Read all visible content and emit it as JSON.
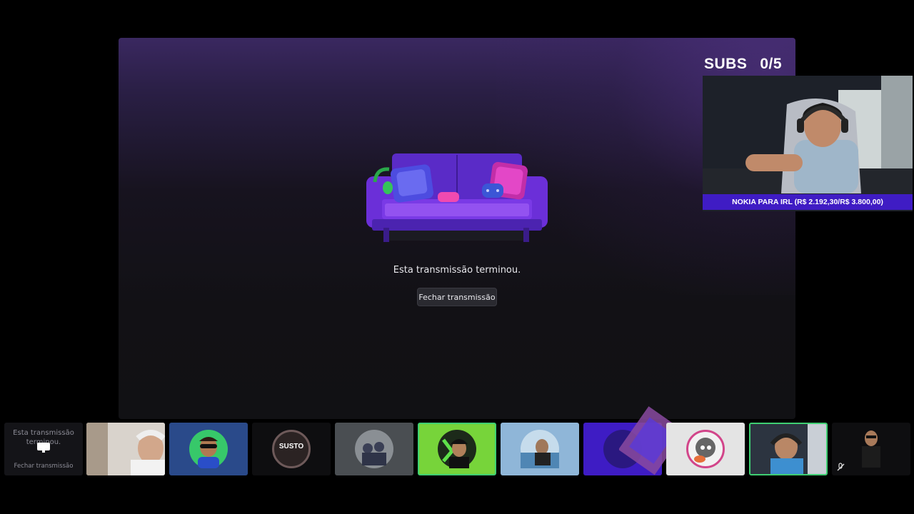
{
  "stage": {
    "ended_message": "Esta transmissão terminou.",
    "close_button": "Fechar transmissão"
  },
  "overlay": {
    "subs_label": "SUBS",
    "subs_count": "0/5",
    "goal_text": "NOKIA PARA IRL (R$ 2.192,30/R$ 3.800,00)"
  },
  "strip": {
    "mini_ended_message": "Esta transmissão terminou.",
    "mini_close_button": "Fechar transmissão",
    "avatar_text_3": "SUSTO"
  },
  "colors": {
    "goal_bar": "#3f1cc4",
    "active_tile_border": "#3ecf72",
    "stage_top": "#3a2860"
  }
}
